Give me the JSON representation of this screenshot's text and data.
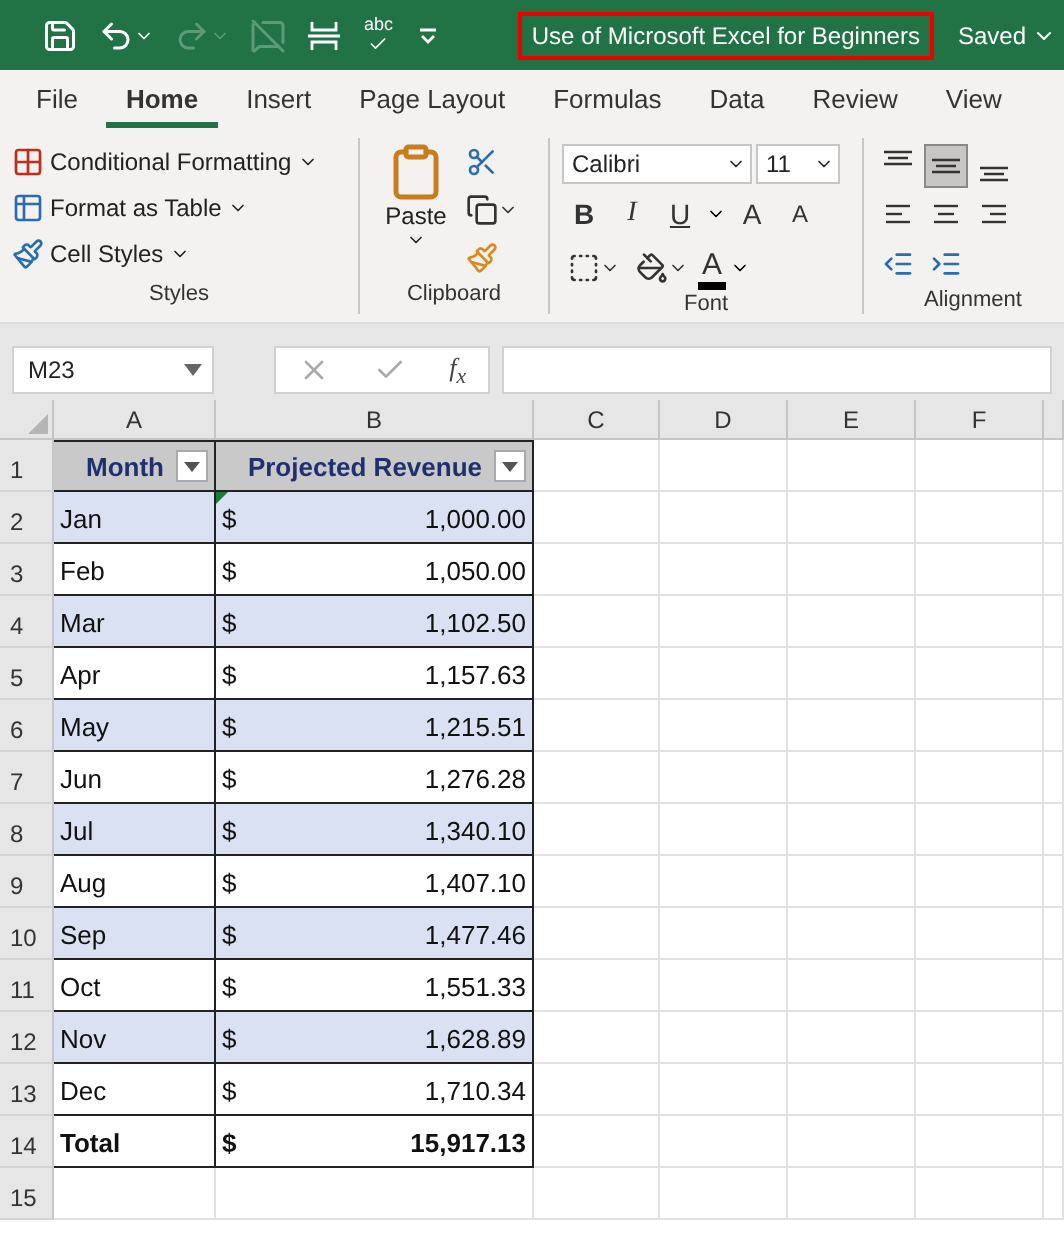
{
  "quick_access": [
    {
      "kind": "save",
      "disabled": false
    },
    {
      "kind": "undo",
      "disabled": false
    },
    {
      "kind": "redo",
      "disabled": true
    },
    {
      "kind": "comment",
      "disabled": true
    },
    {
      "kind": "page-break",
      "disabled": false
    },
    {
      "kind": "spelling",
      "disabled": false,
      "label": "abc"
    },
    {
      "kind": "customize",
      "disabled": false
    }
  ],
  "document_title": "Use of Microsoft Excel for Beginners",
  "save_status": "Saved",
  "ribbon_tabs": [
    {
      "label": "File",
      "selected": false
    },
    {
      "label": "Home",
      "selected": true
    },
    {
      "label": "Insert",
      "selected": false
    },
    {
      "label": "Page Layout",
      "selected": false
    },
    {
      "label": "Formulas",
      "selected": false
    },
    {
      "label": "Data",
      "selected": false
    },
    {
      "label": "Review",
      "selected": false
    },
    {
      "label": "View",
      "selected": false
    }
  ],
  "styles_group": {
    "label": "Styles",
    "items": [
      "Conditional Formatting",
      "Format as Table",
      "Cell Styles"
    ]
  },
  "clipboard_group": {
    "label": "Clipboard",
    "paste": "Paste"
  },
  "font_group": {
    "label": "Font",
    "font_name": "Calibri",
    "font_size": "11",
    "bold": "B",
    "italic": "I",
    "underline": "U",
    "grow": "A",
    "shrink": "A",
    "font_color": "A"
  },
  "alignment_group": {
    "label": "Alignment",
    "vertical": [
      {
        "kind": "top",
        "selected": false
      },
      {
        "kind": "middle",
        "selected": true
      },
      {
        "kind": "bottom",
        "selected": false
      }
    ]
  },
  "name_box": "M23",
  "function_label": "f$_{x}$",
  "columns": [
    "A",
    "B",
    "C",
    "D",
    "E",
    "F"
  ],
  "table": {
    "headers": [
      "Month",
      "Projected Revenue"
    ],
    "rows": [
      {
        "month": "Jan",
        "currency": "$",
        "amount": "1,000.00",
        "banded": true
      },
      {
        "month": "Feb",
        "currency": "$",
        "amount": "1,050.00",
        "banded": false
      },
      {
        "month": "Mar",
        "currency": "$",
        "amount": "1,102.50",
        "banded": true
      },
      {
        "month": "Apr",
        "currency": "$",
        "amount": "1,157.63",
        "banded": false
      },
      {
        "month": "May",
        "currency": "$",
        "amount": "1,215.51",
        "banded": true
      },
      {
        "month": "Jun",
        "currency": "$",
        "amount": "1,276.28",
        "banded": false
      },
      {
        "month": "Jul",
        "currency": "$",
        "amount": "1,340.10",
        "banded": true
      },
      {
        "month": "Aug",
        "currency": "$",
        "amount": "1,407.10",
        "banded": false
      },
      {
        "month": "Sep",
        "currency": "$",
        "amount": "1,477.46",
        "banded": true
      },
      {
        "month": "Oct",
        "currency": "$",
        "amount": "1,551.33",
        "banded": false
      },
      {
        "month": "Nov",
        "currency": "$",
        "amount": "1,628.89",
        "banded": true
      },
      {
        "month": "Dec",
        "currency": "$",
        "amount": "1,710.34",
        "banded": false
      }
    ],
    "total": {
      "month": "Total",
      "currency": "$",
      "amount": "15,917.13"
    }
  },
  "row_numbers": [
    "1",
    "2",
    "3",
    "4",
    "5",
    "6",
    "7",
    "8",
    "9",
    "10",
    "11",
    "12",
    "13",
    "14",
    "15"
  ]
}
